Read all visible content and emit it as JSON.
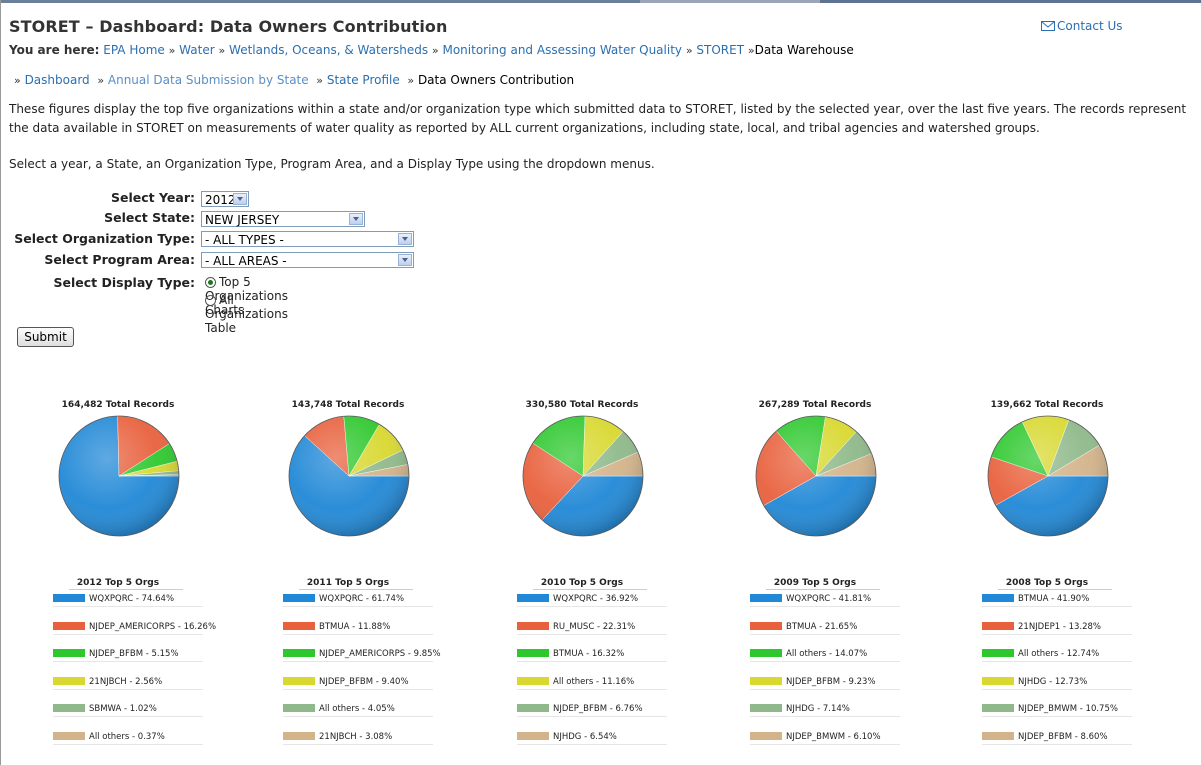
{
  "title": "STORET – Dashboard: Data Owners Contribution",
  "contact": "Contact Us",
  "breadcrumb": {
    "lead": "You are here:",
    "links": [
      "EPA Home",
      "Water",
      "Wetlands, Oceans, & Watersheds",
      "Monitoring and Assessing Water Quality",
      "STORET"
    ],
    "current": "Data Warehouse",
    "separator": "»"
  },
  "subnav": {
    "links": [
      "Dashboard",
      "Annual Data Submission by State",
      "State Profile"
    ],
    "current": "Data Owners Contribution"
  },
  "description": "These figures display the top five organizations within a state and/or organization type which submitted data to STORET, listed by the selected year, over the last five years. The records represent the data available in STORET on measurements of water quality as reported by ALL current organizations, including state, local, and tribal agencies and watershed groups.",
  "instructions": "Select a year, a State, an Organization Type, Program Area, and a Display Type using the dropdown menus.",
  "form": {
    "year_label": "Select Year:",
    "year_value": "2012",
    "state_label": "Select State:",
    "state_value": "NEW JERSEY",
    "orgtype_label": "Select Organization Type:",
    "orgtype_value": "- ALL TYPES -",
    "program_label": "Select Program Area:",
    "program_value": "- ALL AREAS -",
    "display_label": "Select Display Type:",
    "display_options": [
      "Top 5 Organizations Charts",
      "All Organizations Table"
    ],
    "display_selected": 0,
    "submit_label": "Submit"
  },
  "colors": {
    "blue": "#2088d6",
    "red": "#e8603c",
    "green": "#2ec82e",
    "yellow": "#d8d830",
    "sage": "#8fb98a",
    "tan": "#d3b38a",
    "link": "#2b6fb0"
  },
  "chart_data": [
    {
      "type": "pie",
      "title": "164,482 Total Records",
      "legend_title": "2012 Top 5 Orgs",
      "labels": [
        "WQXPQRC - 74.64%",
        "NJDEP_AMERICORPS - 16.26%",
        "NJDEP_BFBM - 5.15%",
        "21NJBCH - 2.56%",
        "SBMWA - 1.02%",
        "All others - 0.37%"
      ],
      "values": [
        74.64,
        16.26,
        5.15,
        2.56,
        1.02,
        0.37
      ],
      "colors": [
        "blue",
        "red",
        "green",
        "yellow",
        "sage",
        "tan"
      ]
    },
    {
      "type": "pie",
      "title": "143,748 Total Records",
      "legend_title": "2011 Top 5 Orgs",
      "labels": [
        "WQXPQRC - 61.74%",
        "BTMUA - 11.88%",
        "NJDEP_AMERICORPS - 9.85%",
        "NJDEP_BFBM - 9.40%",
        "All others - 4.05%",
        "21NJBCH - 3.08%"
      ],
      "values": [
        61.74,
        11.88,
        9.85,
        9.4,
        4.05,
        3.08
      ],
      "colors": [
        "blue",
        "red",
        "green",
        "yellow",
        "sage",
        "tan"
      ]
    },
    {
      "type": "pie",
      "title": "330,580 Total Records",
      "legend_title": "2010 Top 5 Orgs",
      "labels": [
        "WQXPQRC - 36.92%",
        "RU_MUSC - 22.31%",
        "BTMUA - 16.32%",
        "All others - 11.16%",
        "NJDEP_BFBM - 6.76%",
        "NJHDG - 6.54%"
      ],
      "values": [
        36.92,
        22.31,
        16.32,
        11.16,
        6.76,
        6.54
      ],
      "colors": [
        "blue",
        "red",
        "green",
        "yellow",
        "sage",
        "tan"
      ]
    },
    {
      "type": "pie",
      "title": "267,289 Total Records",
      "legend_title": "2009 Top 5 Orgs",
      "labels": [
        "WQXPQRC - 41.81%",
        "BTMUA - 21.65%",
        "All others - 14.07%",
        "NJDEP_BFBM - 9.23%",
        "NJHDG - 7.14%",
        "NJDEP_BMWM - 6.10%"
      ],
      "values": [
        41.81,
        21.65,
        14.07,
        9.23,
        7.14,
        6.1
      ],
      "colors": [
        "blue",
        "red",
        "green",
        "yellow",
        "sage",
        "tan"
      ]
    },
    {
      "type": "pie",
      "title": "139,662 Total Records",
      "legend_title": "2008 Top 5 Orgs",
      "labels": [
        "BTMUA - 41.90%",
        "21NJDEP1 - 13.28%",
        "All others - 12.74%",
        "NJHDG - 12.73%",
        "NJDEP_BMWM - 10.75%",
        "NJDEP_BFBM - 8.60%"
      ],
      "values": [
        41.9,
        13.28,
        12.74,
        12.73,
        10.75,
        8.6
      ],
      "colors": [
        "blue",
        "red",
        "green",
        "yellow",
        "sage",
        "tan"
      ]
    }
  ]
}
